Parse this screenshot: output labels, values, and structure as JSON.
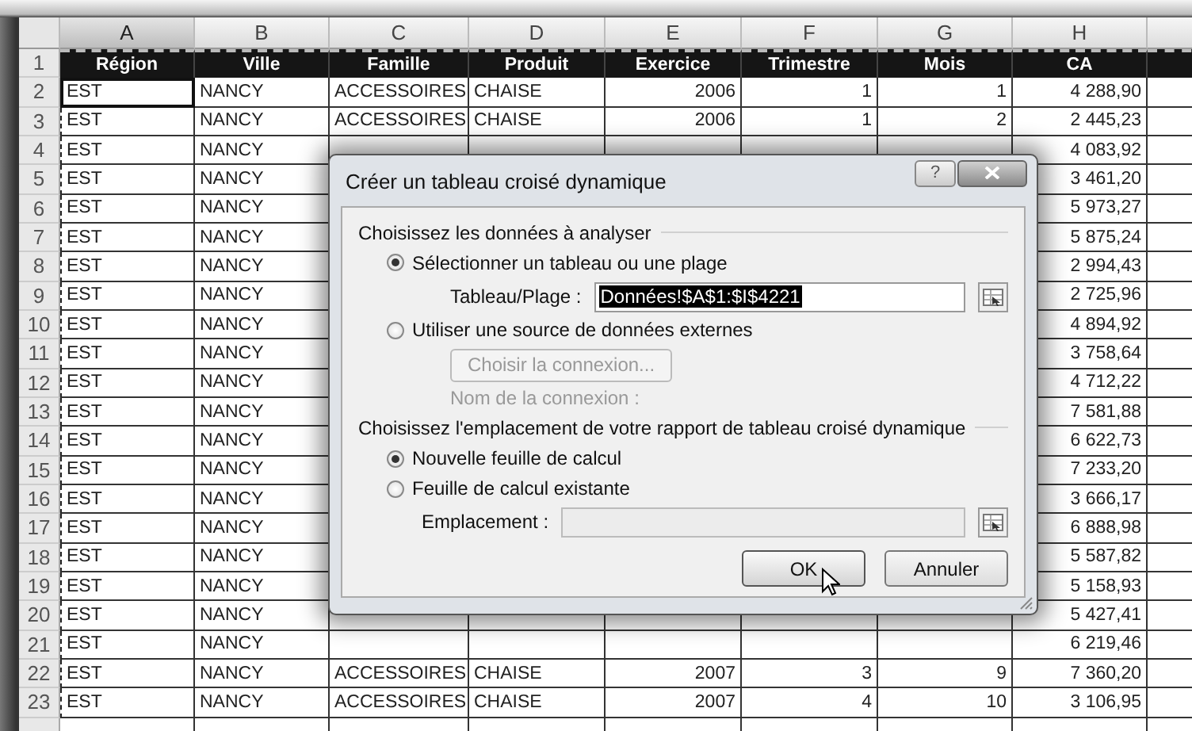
{
  "sheet": {
    "columns": [
      {
        "label": "A",
        "selected": true
      },
      {
        "label": "B",
        "selected": false
      },
      {
        "label": "C",
        "selected": false
      },
      {
        "label": "D",
        "selected": false
      },
      {
        "label": "E",
        "selected": false
      },
      {
        "label": "F",
        "selected": false
      },
      {
        "label": "G",
        "selected": false
      },
      {
        "label": "H",
        "selected": false
      }
    ],
    "header_row": {
      "number": "1",
      "cells": [
        "Région",
        "Ville",
        "Famille",
        "Produit",
        "Exercice",
        "Trimestre",
        "Mois",
        "CA"
      ]
    },
    "rows": [
      {
        "number": "2",
        "selected": true,
        "cells": [
          "EST",
          "NANCY",
          "ACCESSOIRES",
          "CHAISE",
          "2006",
          "1",
          "1",
          "4 288,90"
        ]
      },
      {
        "number": "3",
        "selected": false,
        "cells": [
          "EST",
          "NANCY",
          "ACCESSOIRES",
          "CHAISE",
          "2006",
          "1",
          "2",
          "2 445,23"
        ]
      },
      {
        "number": "4",
        "selected": false,
        "cells": [
          "EST",
          "NANCY",
          null,
          null,
          null,
          null,
          null,
          "4 083,92"
        ]
      },
      {
        "number": "5",
        "selected": false,
        "cells": [
          "EST",
          "NANCY",
          null,
          null,
          null,
          null,
          null,
          "3 461,20"
        ]
      },
      {
        "number": "6",
        "selected": false,
        "cells": [
          "EST",
          "NANCY",
          null,
          null,
          null,
          null,
          null,
          "5 973,27"
        ]
      },
      {
        "number": "7",
        "selected": false,
        "cells": [
          "EST",
          "NANCY",
          null,
          null,
          null,
          null,
          null,
          "5 875,24"
        ]
      },
      {
        "number": "8",
        "selected": false,
        "cells": [
          "EST",
          "NANCY",
          null,
          null,
          null,
          null,
          null,
          "2 994,43"
        ]
      },
      {
        "number": "9",
        "selected": false,
        "cells": [
          "EST",
          "NANCY",
          null,
          null,
          null,
          null,
          null,
          "2 725,96"
        ]
      },
      {
        "number": "10",
        "selected": false,
        "cells": [
          "EST",
          "NANCY",
          null,
          null,
          null,
          null,
          null,
          "4 894,92"
        ]
      },
      {
        "number": "11",
        "selected": false,
        "cells": [
          "EST",
          "NANCY",
          null,
          null,
          null,
          null,
          null,
          "3 758,64"
        ]
      },
      {
        "number": "12",
        "selected": false,
        "cells": [
          "EST",
          "NANCY",
          null,
          null,
          null,
          null,
          null,
          "4 712,22"
        ]
      },
      {
        "number": "13",
        "selected": false,
        "cells": [
          "EST",
          "NANCY",
          null,
          null,
          null,
          null,
          null,
          "7 581,88"
        ]
      },
      {
        "number": "14",
        "selected": false,
        "cells": [
          "EST",
          "NANCY",
          null,
          null,
          null,
          null,
          null,
          "6 622,73"
        ]
      },
      {
        "number": "15",
        "selected": false,
        "cells": [
          "EST",
          "NANCY",
          null,
          null,
          null,
          null,
          null,
          "7 233,20"
        ]
      },
      {
        "number": "16",
        "selected": false,
        "cells": [
          "EST",
          "NANCY",
          null,
          null,
          null,
          null,
          null,
          "3 666,17"
        ]
      },
      {
        "number": "17",
        "selected": false,
        "cells": [
          "EST",
          "NANCY",
          null,
          null,
          null,
          null,
          null,
          "6 888,98"
        ]
      },
      {
        "number": "18",
        "selected": false,
        "cells": [
          "EST",
          "NANCY",
          null,
          null,
          null,
          null,
          null,
          "5 587,82"
        ]
      },
      {
        "number": "19",
        "selected": false,
        "cells": [
          "EST",
          "NANCY",
          null,
          null,
          null,
          null,
          null,
          "5 158,93"
        ]
      },
      {
        "number": "20",
        "selected": false,
        "cells": [
          "EST",
          "NANCY",
          null,
          null,
          null,
          null,
          null,
          "5 427,41"
        ]
      },
      {
        "number": "21",
        "selected": false,
        "cells": [
          "EST",
          "NANCY",
          null,
          null,
          null,
          null,
          null,
          "6 219,46"
        ]
      },
      {
        "number": "22",
        "selected": false,
        "cells": [
          "EST",
          "NANCY",
          "ACCESSOIRES",
          "CHAISE",
          "2007",
          "3",
          "9",
          "7 360,20"
        ]
      },
      {
        "number": "23",
        "selected": false,
        "cells": [
          "EST",
          "NANCY",
          "ACCESSOIRES",
          "CHAISE",
          "2007",
          "4",
          "10",
          "3 106,95"
        ]
      }
    ]
  },
  "dialog": {
    "title": "Créer un tableau croisé dynamique",
    "help": "?",
    "section_1": "Choisissez les données à analyser",
    "source_options": [
      {
        "label": "Sélectionner un tableau ou une plage",
        "selected": true
      },
      {
        "label": "Utiliser une source de données externes",
        "selected": false
      }
    ],
    "range_field": {
      "label": "Tableau/Plage :",
      "value": "Données!$A$1:$I$4221"
    },
    "connection_button": {
      "label": "Choisir la connexion...",
      "disabled": true
    },
    "connection_name": {
      "label": "Nom de la connexion :",
      "disabled": true
    },
    "section_2": "Choisissez l'emplacement de votre rapport de tableau croisé dynamique",
    "destination_options": [
      {
        "label": "Nouvelle feuille de calcul",
        "selected": true
      },
      {
        "label": "Feuille de calcul existante",
        "selected": false
      }
    ],
    "location_field": {
      "label": "Emplacement :",
      "disabled": true
    },
    "buttons": [
      {
        "label": "OK",
        "hovered": true
      },
      {
        "label": "Annuler",
        "hovered": false
      }
    ]
  }
}
